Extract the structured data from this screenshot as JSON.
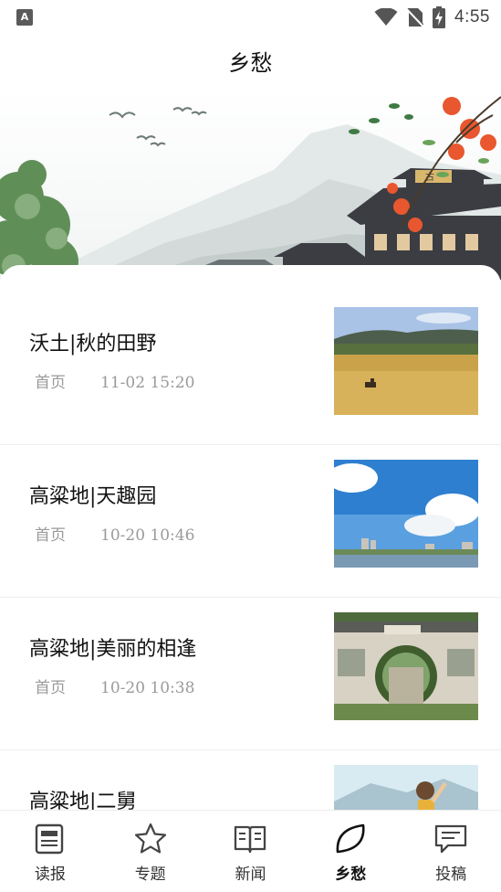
{
  "status_bar": {
    "time": "4:55",
    "app_icon_letter": "A",
    "icons": [
      "wifi-icon",
      "no-sim-icon",
      "battery-charging-icon"
    ]
  },
  "header": {
    "title": "乡愁"
  },
  "banner": {
    "theme": "ink-wash landscape with mountains, birds, trees, blossoms and traditional buildings",
    "sign_text": "古"
  },
  "articles": [
    {
      "title": "沃土|秋的田野",
      "source": "首页",
      "date": "11-02",
      "time": "15:20",
      "thumbnail": "autumn-field-photo"
    },
    {
      "title": "高粱地|天趣园",
      "source": "首页",
      "date": "10-20",
      "time": "10:46",
      "thumbnail": "blue-sky-lake-photo"
    },
    {
      "title": "高粱地|美丽的相逢",
      "source": "首页",
      "date": "10-20",
      "time": "10:38",
      "thumbnail": "moon-gate-garden-photo"
    },
    {
      "title": "高粱地|二舅",
      "thumbnail": "illustration-person-mountains"
    }
  ],
  "bottom_nav": {
    "active_index": 3,
    "items": [
      {
        "label": "读报",
        "icon": "newspaper-icon"
      },
      {
        "label": "专题",
        "icon": "star-icon"
      },
      {
        "label": "新闻",
        "icon": "open-book-icon"
      },
      {
        "label": "乡愁",
        "icon": "leaf-icon"
      },
      {
        "label": "投稿",
        "icon": "message-icon"
      }
    ]
  },
  "colors": {
    "background": "#ffffff",
    "title_text": "#111111",
    "meta_text": "#9a9a9a",
    "divider": "#eeeeee",
    "blossom": "#e8572f"
  }
}
